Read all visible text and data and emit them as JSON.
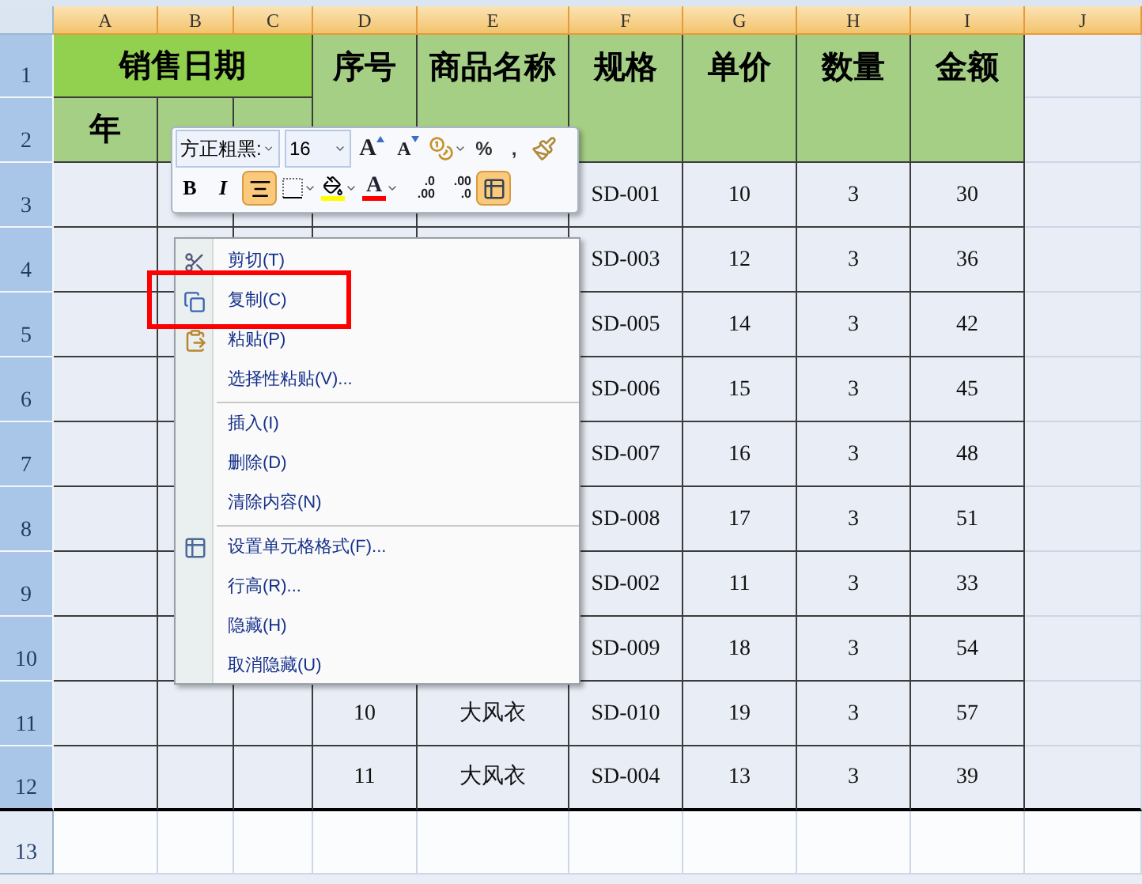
{
  "columns": [
    {
      "label": "A",
      "selected": true
    },
    {
      "label": "B",
      "selected": true
    },
    {
      "label": "C",
      "selected": true
    },
    {
      "label": "D",
      "selected": true
    },
    {
      "label": "E",
      "selected": true
    },
    {
      "label": "F",
      "selected": true
    },
    {
      "label": "G",
      "selected": true
    },
    {
      "label": "H",
      "selected": true
    },
    {
      "label": "I",
      "selected": true
    },
    {
      "label": "J",
      "selected": true
    }
  ],
  "row_numbers": [
    {
      "label": "1",
      "selected": true
    },
    {
      "label": "2",
      "selected": true
    },
    {
      "label": "3",
      "selected": true
    },
    {
      "label": "4",
      "selected": true
    },
    {
      "label": "5",
      "selected": true
    },
    {
      "label": "6",
      "selected": true
    },
    {
      "label": "7",
      "selected": true
    },
    {
      "label": "8",
      "selected": true
    },
    {
      "label": "9",
      "selected": true
    },
    {
      "label": "10",
      "selected": true
    },
    {
      "label": "11",
      "selected": true
    },
    {
      "label": "12",
      "selected": true
    },
    {
      "label": "13",
      "selected": false
    }
  ],
  "header": {
    "date_group": "销售日期",
    "year": "年",
    "columns": [
      "序号",
      "商品名称",
      "规格",
      "单价",
      "数量",
      "金额"
    ]
  },
  "data_rows": [
    {
      "spec": "SD-001",
      "price": "10",
      "qty": "3",
      "amount": "30"
    },
    {
      "spec": "SD-003",
      "price": "12",
      "qty": "3",
      "amount": "36"
    },
    {
      "spec": "SD-005",
      "price": "14",
      "qty": "3",
      "amount": "42"
    },
    {
      "spec": "SD-006",
      "price": "15",
      "qty": "3",
      "amount": "45"
    },
    {
      "spec": "SD-007",
      "price": "16",
      "qty": "3",
      "amount": "48"
    },
    {
      "spec": "SD-008",
      "price": "17",
      "qty": "3",
      "amount": "51"
    },
    {
      "spec": "SD-002",
      "price": "11",
      "qty": "3",
      "amount": "33"
    },
    {
      "spec": "SD-009",
      "price": "18",
      "qty": "3",
      "amount": "54"
    },
    {
      "id": "10",
      "name": "大风衣",
      "spec": "SD-010",
      "price": "19",
      "qty": "3",
      "amount": "57"
    },
    {
      "id": "11",
      "name": "大风衣",
      "spec": "SD-004",
      "price": "13",
      "qty": "3",
      "amount": "39"
    }
  ],
  "mini_toolbar": {
    "font_row": [
      {
        "kind": "font",
        "text": "方正粗黑:"
      },
      {
        "kind": "size",
        "text": "16"
      },
      {
        "kind": "grow",
        "text": "A"
      },
      {
        "kind": "shrink",
        "text": "A"
      },
      {
        "kind": "currency"
      },
      {
        "kind": "glyph",
        "text": "%"
      },
      {
        "kind": "glyph",
        "text": ","
      },
      {
        "kind": "painter"
      }
    ],
    "format_row": [
      {
        "kind": "bold",
        "text": "B"
      },
      {
        "kind": "italic",
        "text": "I"
      },
      {
        "kind": "align",
        "selected": true
      },
      {
        "kind": "borders"
      },
      {
        "kind": "fill",
        "color": "#ffff00"
      },
      {
        "kind": "fontcolor",
        "text": "A",
        "color": "#ff0000"
      },
      {
        "kind": "decimal",
        "top": ".0",
        "bottom": ".00"
      },
      {
        "kind": "decimal",
        "top": ".00",
        "bottom": ".0"
      },
      {
        "kind": "merge",
        "selected": true
      }
    ]
  },
  "context_menu": [
    {
      "kind": "cut",
      "label": "剪切(T)",
      "highlighted": false
    },
    {
      "kind": "copy",
      "label": "复制(C)",
      "highlighted": true
    },
    {
      "kind": "paste",
      "label": "粘贴(P)",
      "highlighted": false
    },
    {
      "kind": "item",
      "label": "选择性粘贴(V)...",
      "highlighted": false
    },
    {
      "kind": "separator"
    },
    {
      "kind": "item",
      "label": "插入(I)",
      "highlighted": false
    },
    {
      "kind": "item",
      "label": "删除(D)",
      "highlighted": false
    },
    {
      "kind": "item",
      "label": "清除内容(N)",
      "highlighted": false
    },
    {
      "kind": "separator"
    },
    {
      "kind": "format",
      "label": "设置单元格格式(F)...",
      "highlighted": false
    },
    {
      "kind": "item",
      "label": "行高(R)...",
      "highlighted": false
    },
    {
      "kind": "item",
      "label": "隐藏(H)",
      "highlighted": false
    },
    {
      "kind": "item",
      "label": "取消隐藏(U)",
      "highlighted": false
    }
  ]
}
